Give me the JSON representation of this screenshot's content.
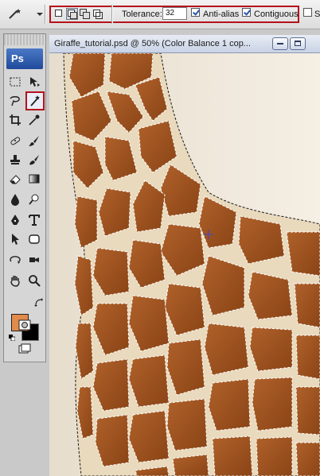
{
  "options_bar": {
    "tolerance_label": "Tolerance:",
    "tolerance_value": "32",
    "anti_alias_label": "Anti-alias",
    "anti_alias_checked": true,
    "contiguous_label": "Contiguous",
    "contiguous_checked": true,
    "sample_all_layers_label": "Sa",
    "sample_all_layers_checked": false,
    "active_selection_mode": "new-selection",
    "highlight_color": "#b5121b"
  },
  "document": {
    "title": "Giraffe_tutorial.psd @ 50% (Color Balance 1 cop..."
  },
  "tools_panel": {
    "badge": "Ps",
    "active_tool": "magic-wand-tool",
    "foreground_color": "#e08a4c",
    "background_color": "#000000"
  }
}
